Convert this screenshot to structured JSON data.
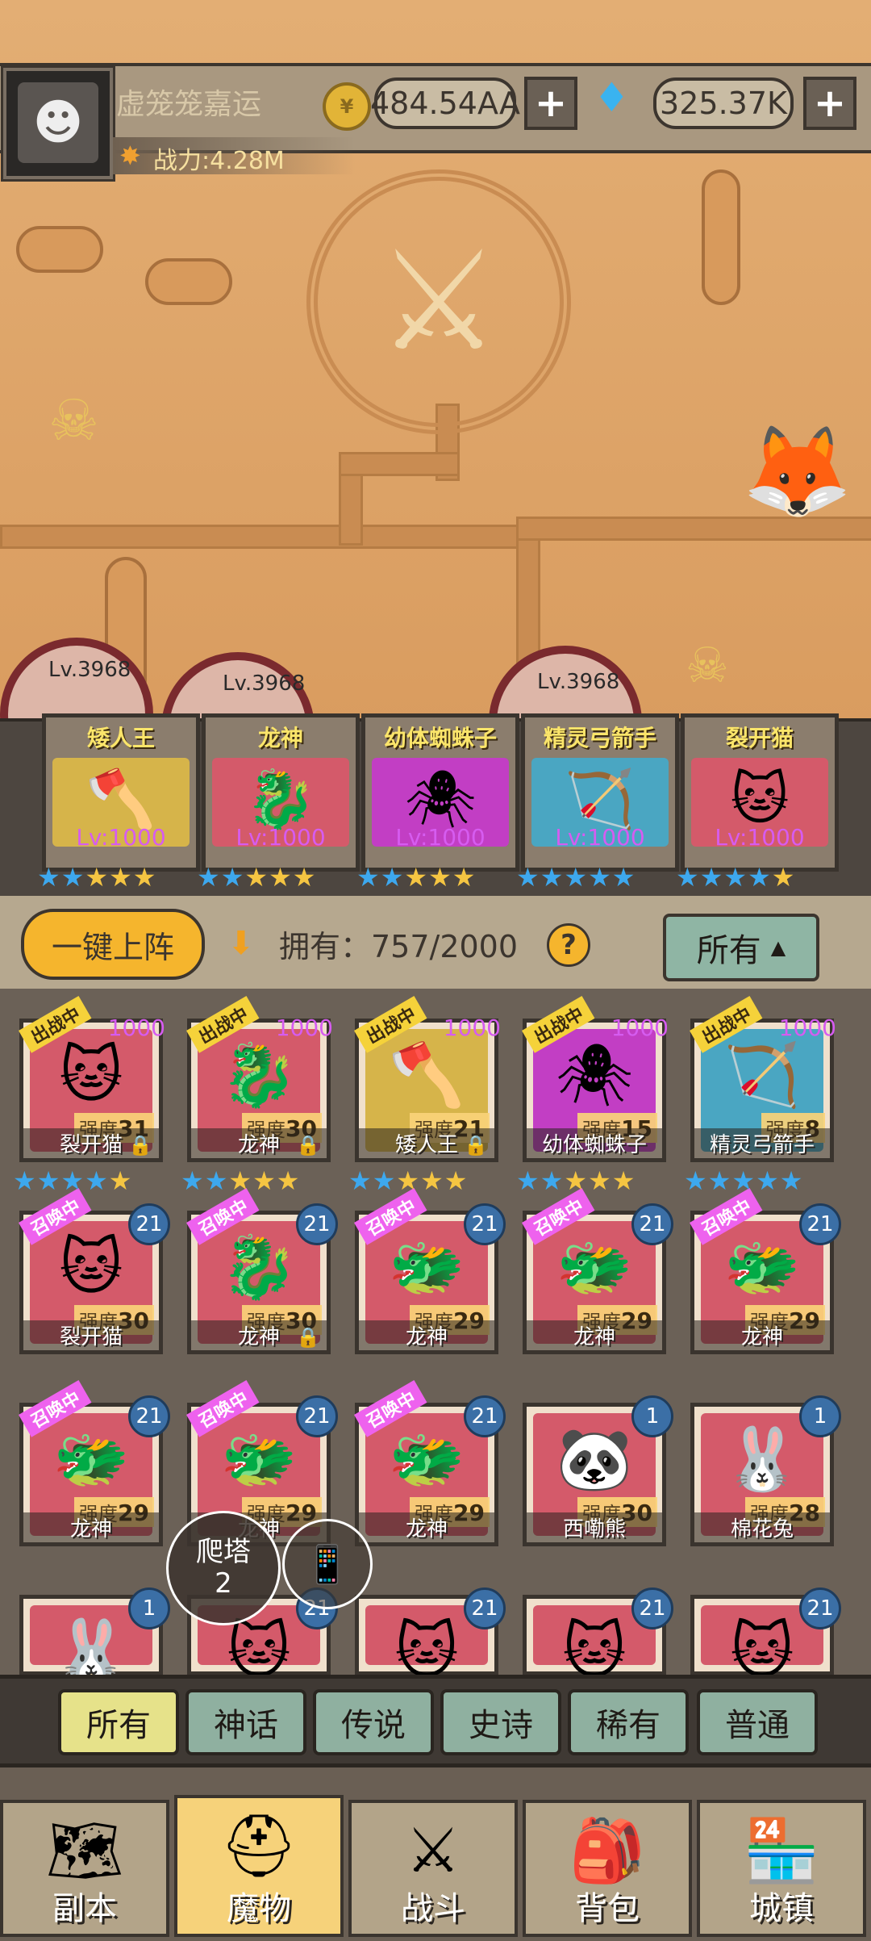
{
  "player": {
    "name": "虚笼笼嘉运",
    "power": "战力:4.28M",
    "coins": "484.54AA",
    "gems": "325.37K",
    "plus": "+"
  },
  "arena_levels": [
    "Lv.3968",
    "Lv.3968",
    "Lv.3968"
  ],
  "team": [
    {
      "name": "矮人王",
      "level": "Lv:1000",
      "color": "#d6b44a",
      "icon": "dwarf-king-icon",
      "glyph": "🪓"
    },
    {
      "name": "龙神",
      "level": "Lv:1000",
      "color": "#d45a6a",
      "icon": "dragon-god-icon",
      "glyph": "🐉"
    },
    {
      "name": "幼体蜘蛛子",
      "level": "Lv:1000",
      "color": "#c23ec4",
      "icon": "spider-icon",
      "glyph": "🕷"
    },
    {
      "name": "精灵弓箭手",
      "level": "Lv:1000",
      "color": "#4aa6c2",
      "icon": "elf-archer-icon",
      "glyph": "🏹"
    },
    {
      "name": "裂开猫",
      "level": "Lv:1000",
      "color": "#d45a6a",
      "icon": "cat-girl-icon",
      "glyph": "🐱"
    }
  ],
  "team_stars": [
    [
      "b",
      "b",
      "y",
      "y",
      "y"
    ],
    [
      "b",
      "b",
      "y",
      "y",
      "y"
    ],
    [
      "b",
      "b",
      "y",
      "y",
      "y"
    ],
    [
      "b",
      "b",
      "b",
      "b",
      "b"
    ],
    [
      "b",
      "b",
      "b",
      "b",
      "y"
    ]
  ],
  "toolbar": {
    "deploy": "一键上阵",
    "owned": "拥有：757/2000",
    "help": "?",
    "filter": "所有"
  },
  "monsters": [
    {
      "name": "裂开猫",
      "str_label": "强度",
      "str": "31",
      "tag": "出战中",
      "tag_type": "fight",
      "lvl": "1000",
      "lock": true,
      "color": "#d45a6a",
      "glyph": "🐱"
    },
    {
      "name": "龙神",
      "str_label": "强度",
      "str": "30",
      "tag": "出战中",
      "tag_type": "fight",
      "lvl": "1000",
      "lock": true,
      "color": "#d45a6a",
      "glyph": "🐉"
    },
    {
      "name": "矮人王",
      "str_label": "强度",
      "str": "21",
      "tag": "出战中",
      "tag_type": "fight",
      "lvl": "1000",
      "lock": true,
      "color": "#d6b44a",
      "glyph": "🪓"
    },
    {
      "name": "幼体蜘蛛子",
      "str_label": "强度",
      "str": "15",
      "tag": "出战中",
      "tag_type": "fight",
      "lvl": "1000",
      "lock": false,
      "color": "#c23ec4",
      "glyph": "🕷"
    },
    {
      "name": "精灵弓箭手",
      "str_label": "强度",
      "str": "8",
      "tag": "出战中",
      "tag_type": "fight",
      "lvl": "1000",
      "lock": false,
      "color": "#4aa6c2",
      "glyph": "🏹"
    },
    {
      "name": "裂开猫",
      "str_label": "强度",
      "str": "30",
      "tag": "召唤中",
      "tag_type": "summon",
      "badge": "21",
      "lock": false,
      "color": "#d45a6a",
      "glyph": "🐱"
    },
    {
      "name": "龙神",
      "str_label": "强度",
      "str": "30",
      "tag": "召唤中",
      "tag_type": "summon",
      "badge": "21",
      "lock": true,
      "color": "#d45a6a",
      "glyph": "🐉"
    },
    {
      "name": "龙神",
      "str_label": "强度",
      "str": "29",
      "tag": "召唤中",
      "tag_type": "summon",
      "badge": "21",
      "lock": false,
      "color": "#d45a6a",
      "glyph": "🐲"
    },
    {
      "name": "龙神",
      "str_label": "强度",
      "str": "29",
      "tag": "召唤中",
      "tag_type": "summon",
      "badge": "21",
      "lock": false,
      "color": "#d45a6a",
      "glyph": "🐲"
    },
    {
      "name": "龙神",
      "str_label": "强度",
      "str": "29",
      "tag": "召唤中",
      "tag_type": "summon",
      "badge": "21",
      "lock": false,
      "color": "#d45a6a",
      "glyph": "🐲"
    },
    {
      "name": "龙神",
      "str_label": "强度",
      "str": "29",
      "tag": "召唤中",
      "tag_type": "summon",
      "badge": "21",
      "lock": false,
      "color": "#d45a6a",
      "glyph": "🐲"
    },
    {
      "name": "龙神",
      "str_label": "强度",
      "str": "29",
      "tag": "召唤中",
      "tag_type": "summon",
      "badge": "21",
      "lock": false,
      "color": "#d45a6a",
      "glyph": "🐲"
    },
    {
      "name": "龙神",
      "str_label": "强度",
      "str": "29",
      "tag": "召唤中",
      "tag_type": "summon",
      "badge": "21",
      "lock": false,
      "color": "#d45a6a",
      "glyph": "🐲"
    },
    {
      "name": "西嘞熊",
      "str_label": "强度",
      "str": "30",
      "tag": "",
      "tag_type": "",
      "badge": "1",
      "lock": false,
      "color": "#d45a6a",
      "glyph": "🐼"
    },
    {
      "name": "棉花兔",
      "str_label": "强度",
      "str": "28",
      "tag": "",
      "tag_type": "",
      "badge": "1",
      "lock": false,
      "color": "#d45a6a",
      "glyph": "🐰"
    },
    {
      "name": "",
      "str_label": "",
      "str": "",
      "tag": "",
      "tag_type": "",
      "badge": "1",
      "lock": false,
      "color": "#d45a6a",
      "glyph": "🐰"
    },
    {
      "name": "",
      "str_label": "",
      "str": "",
      "tag": "",
      "tag_type": "",
      "badge": "21",
      "lock": false,
      "color": "#d45a6a",
      "glyph": "🐱"
    },
    {
      "name": "",
      "str_label": "",
      "str": "",
      "tag": "",
      "tag_type": "",
      "badge": "21",
      "lock": false,
      "color": "#d45a6a",
      "glyph": "🐱"
    },
    {
      "name": "",
      "str_label": "",
      "str": "",
      "tag": "",
      "tag_type": "",
      "badge": "21",
      "lock": false,
      "color": "#d45a6a",
      "glyph": "🐱"
    },
    {
      "name": "",
      "str_label": "",
      "str": "",
      "tag": "",
      "tag_type": "",
      "badge": "21",
      "lock": false,
      "color": "#d45a6a",
      "glyph": "🐱"
    }
  ],
  "grid_stars": [
    [
      "b",
      "b",
      "b",
      "b",
      "y"
    ],
    [
      "b",
      "b",
      "y",
      "y",
      "y"
    ],
    [
      "b",
      "b",
      "y",
      "y",
      "y"
    ],
    [
      "b",
      "b",
      "y",
      "y",
      "y"
    ],
    [
      "b",
      "b",
      "b",
      "b",
      "b"
    ]
  ],
  "climb": {
    "label": "爬塔",
    "count": "2"
  },
  "rarity_tabs": [
    "所有",
    "神话",
    "传说",
    "史诗",
    "稀有",
    "普通"
  ],
  "nav": [
    {
      "label": "副本",
      "icon": "map-scroll-icon",
      "glyph": "🗺"
    },
    {
      "label": "魔物",
      "icon": "monster-helmet-icon",
      "glyph": "⛑"
    },
    {
      "label": "战斗",
      "icon": "crossed-swords-icon",
      "glyph": "⚔"
    },
    {
      "label": "背包",
      "icon": "backpack-icon",
      "glyph": "🎒"
    },
    {
      "label": "城镇",
      "icon": "shop-icon",
      "glyph": "🏪"
    }
  ]
}
